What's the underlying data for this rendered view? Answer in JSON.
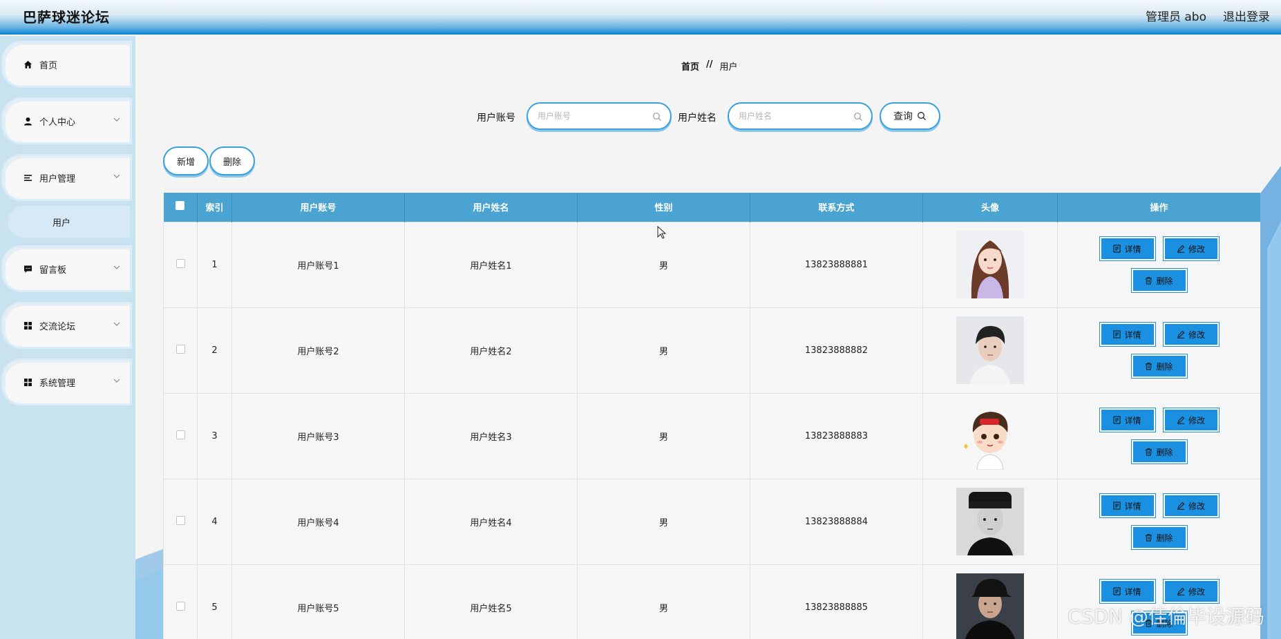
{
  "header": {
    "title": "巴萨球迷论坛",
    "user": "管理员 abo",
    "logout": "退出登录"
  },
  "sidebar": {
    "items": [
      {
        "label": "首页",
        "icon": "home-icon"
      },
      {
        "label": "个人中心",
        "icon": "user-icon"
      },
      {
        "label": "用户管理",
        "icon": "list-icon"
      },
      {
        "label": "留言板",
        "icon": "message-icon"
      },
      {
        "label": "交流论坛",
        "icon": "grid-icon"
      },
      {
        "label": "系统管理",
        "icon": "grid-icon"
      }
    ],
    "submenu": {
      "label": "用户"
    }
  },
  "breadcrumb": {
    "home": "首页",
    "separator": "//",
    "current": "用户"
  },
  "search": {
    "account_label": "用户账号",
    "account_placeholder": "用户账号",
    "name_label": "用户姓名",
    "name_placeholder": "用户姓名",
    "query_label": "查询"
  },
  "toolbar": {
    "add": "新增",
    "delete": "删除"
  },
  "table": {
    "headers": [
      "索引",
      "用户账号",
      "用户姓名",
      "性别",
      "联系方式",
      "头像",
      "操作"
    ],
    "rows": [
      {
        "index": "1",
        "account": "用户账号1",
        "name": "用户姓名1",
        "gender": "男",
        "phone": "13823888881"
      },
      {
        "index": "2",
        "account": "用户账号2",
        "name": "用户姓名2",
        "gender": "男",
        "phone": "13823888882"
      },
      {
        "index": "3",
        "account": "用户账号3",
        "name": "用户姓名3",
        "gender": "男",
        "phone": "13823888883"
      },
      {
        "index": "4",
        "account": "用户账号4",
        "name": "用户姓名4",
        "gender": "男",
        "phone": "13823888884"
      },
      {
        "index": "5",
        "account": "用户账号5",
        "name": "用户姓名5",
        "gender": "男",
        "phone": "13823888885"
      }
    ],
    "actions": {
      "detail": "详情",
      "edit": "修改",
      "delete": "删除"
    }
  },
  "watermark": "CSDN @佳倫毕设源码",
  "colors": {
    "accent": "#1b8fe0",
    "header_bg": "#4ba3d1",
    "sidebar_bg": "#c9e2ef"
  }
}
